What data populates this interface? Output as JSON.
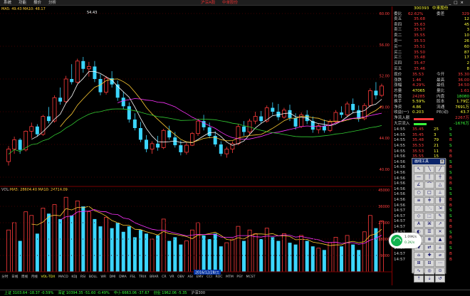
{
  "menu": {
    "items": [
      "系统",
      "功能",
      "报价",
      "分析",
      "扩展市场",
      "资讯",
      "工具",
      "帮助"
    ],
    "center_red": "沪深A股",
    "center_red2": "中单股份",
    "right": "行情 资讯 交易 服务"
  },
  "kline": {
    "ma_legend": "MA5: 49.43  MA10: 48.17",
    "peak_label": "54.43",
    "price_high": 60.0,
    "price_low": 39.0,
    "y_ticks": [
      {
        "v": "60.00"
      },
      {
        "v": "56.00"
      },
      {
        "v": "52.00"
      },
      {
        "v": "48.00"
      },
      {
        "v": "44.00"
      },
      {
        "v": "40.00"
      }
    ],
    "candles": [
      [
        41,
        43,
        40.5,
        42.6
      ],
      [
        42.6,
        44.2,
        42,
        43.8
      ],
      [
        43.8,
        44,
        42,
        42.5
      ],
      [
        42.5,
        45,
        42.3,
        44.9
      ],
      [
        44.9,
        46,
        44,
        45.5
      ],
      [
        45.5,
        45.8,
        44.2,
        44.5
      ],
      [
        44.5,
        47,
        44.3,
        46.8
      ],
      [
        46.8,
        48,
        45.9,
        46.2
      ],
      [
        46.2,
        49.5,
        46,
        49.2
      ],
      [
        49.2,
        50.5,
        48.3,
        48.7
      ],
      [
        48.7,
        52,
        48.5,
        51.6
      ],
      [
        51.6,
        53.5,
        50.9,
        51.2
      ],
      [
        51.2,
        54.2,
        51,
        53.9
      ],
      [
        53.9,
        54.43,
        52.4,
        52.9
      ],
      [
        52.9,
        53.8,
        51.9,
        53.2
      ],
      [
        53.2,
        53.9,
        51.2,
        51.6
      ],
      [
        51.6,
        52.2,
        49.5,
        49.9
      ],
      [
        49.9,
        52,
        49.6,
        51.7
      ],
      [
        51.7,
        52.6,
        50.5,
        50.9
      ],
      [
        50.9,
        51.4,
        48.8,
        49.2
      ],
      [
        49.2,
        50,
        47.7,
        48.1
      ],
      [
        48.1,
        48.6,
        46,
        46.4
      ],
      [
        46.4,
        47.2,
        45,
        45.3
      ],
      [
        45.3,
        46.1,
        43.5,
        43.8
      ],
      [
        43.8,
        44.4,
        42.2,
        42.6
      ],
      [
        42.6,
        43.6,
        42,
        43.3
      ],
      [
        43.3,
        44.3,
        42.4,
        42.8
      ],
      [
        42.8,
        45.2,
        42.6,
        45
      ],
      [
        45,
        45.6,
        43.8,
        44.1
      ],
      [
        44.1,
        44.8,
        42.8,
        43.1
      ],
      [
        43.1,
        43.7,
        41.8,
        42.2
      ],
      [
        42.2,
        43.4,
        41.9,
        43.1
      ],
      [
        43.1,
        44.8,
        43,
        44.6
      ],
      [
        44.6,
        46.5,
        44.3,
        46.2
      ],
      [
        46.2,
        47,
        45,
        45.4
      ],
      [
        45.4,
        46,
        44,
        44.3
      ],
      [
        44.3,
        44.9,
        42.9,
        43.2
      ],
      [
        43.2,
        43.6,
        41.7,
        42
      ],
      [
        42,
        42.9,
        41.5,
        42.6
      ],
      [
        42.6,
        43.6,
        42.1,
        43.3
      ],
      [
        43.3,
        45.8,
        43.1,
        45.5
      ],
      [
        45.5,
        46.2,
        44.3,
        44.8
      ],
      [
        44.8,
        46.5,
        44.5,
        46.2
      ],
      [
        46.2,
        47.4,
        45.8,
        46.8
      ],
      [
        46.8,
        47.5,
        45.9,
        46.2
      ],
      [
        46.2,
        48.2,
        46,
        47.9
      ],
      [
        47.9,
        48.6,
        47,
        47.4
      ],
      [
        47.4,
        48.4,
        46.3,
        46.7
      ],
      [
        46.7,
        47.9,
        46.5,
        47.6
      ],
      [
        47.6,
        48.3,
        46.2,
        46.6
      ],
      [
        46.6,
        47.2,
        45.1,
        45.5
      ],
      [
        45.5,
        47.3,
        45.3,
        47
      ],
      [
        47,
        47.6,
        45.8,
        46.2
      ],
      [
        46.2,
        46.8,
        44.7,
        45.1
      ],
      [
        45.1,
        45.9,
        44.6,
        45.6
      ],
      [
        45.6,
        46.4,
        44.7,
        45
      ],
      [
        45,
        46.4,
        44.8,
        46.1
      ],
      [
        46.1,
        47.6,
        45.9,
        47.3
      ],
      [
        47.3,
        48.1,
        46.6,
        47
      ],
      [
        47,
        48.7,
        46.8,
        48.4
      ],
      [
        48.4,
        49.1,
        47.2,
        47.6
      ],
      [
        47.6,
        48.2,
        46.1,
        46.5
      ],
      [
        46.5,
        48.5,
        46.3,
        48.2
      ],
      [
        48.2,
        50.4,
        48,
        50.1
      ],
      [
        50.1,
        51.2,
        49,
        49.5
      ],
      [
        49.5,
        51,
        49.3,
        50.7
      ]
    ]
  },
  "volume": {
    "legend_name": "VOL:",
    "legend_vals": "MA5: 28604.40  MA10: 24714.09",
    "y_ticks": [
      {
        "v": "45000"
      },
      {
        "v": "36000"
      },
      {
        "v": "27000"
      },
      {
        "v": "18000"
      },
      {
        "v": "9000"
      }
    ],
    "vmax": 45000,
    "values": [
      23,
      27,
      17,
      33,
      31,
      21,
      35,
      32,
      37,
      29,
      41,
      31,
      39,
      36,
      33,
      29,
      25,
      30,
      24,
      27,
      22,
      25,
      19,
      23,
      21,
      18,
      20,
      29,
      17,
      19,
      15,
      17,
      23,
      27,
      20,
      18,
      21,
      14,
      16,
      18,
      25,
      17,
      23,
      21,
      18,
      24,
      19,
      17,
      21,
      16,
      15,
      20,
      17,
      14,
      13,
      12,
      16,
      19,
      14,
      20,
      15,
      12,
      22,
      31,
      24,
      28
    ]
  },
  "date_tag": "2016/12/28/三",
  "tabs": [
    "分时",
    "日线",
    "周线",
    "月线",
    "VOL-TDX",
    "MACD",
    "KDJ",
    "RSI",
    "BOLL",
    "WR",
    "DMI",
    "DMA",
    "FSL",
    "TRIX",
    "BRAR",
    "CR",
    "VR",
    "OBV",
    "ASI",
    "EMV",
    "CCI",
    "ROC",
    "MTM",
    "PSY",
    "MCST"
  ],
  "quote": {
    "code": "300393",
    "name": "中来股份",
    "wei_bi_label": "委比",
    "wei_bi": "62.62%",
    "wei_cha_label": "委差",
    "wei_cha": "329",
    "asks": [
      {
        "n": "卖五",
        "p": "35.68",
        "v": "12"
      },
      {
        "n": "卖四",
        "p": "35.63",
        "v": "45"
      },
      {
        "n": "卖三",
        "p": "35.57",
        "v": "3"
      },
      {
        "n": "卖二",
        "p": "35.55",
        "v": "10"
      },
      {
        "n": "卖一",
        "p": "35.53",
        "v": "26"
      }
    ],
    "bids": [
      {
        "n": "买一",
        "p": "35.51",
        "v": "60"
      },
      {
        "n": "买二",
        "p": "35.50",
        "v": "87"
      },
      {
        "n": "买三",
        "p": "35.48",
        "v": "17"
      },
      {
        "n": "买四",
        "p": "35.47",
        "v": "2"
      },
      {
        "n": "买五",
        "p": "35.46",
        "v": "8"
      }
    ],
    "stats": [
      [
        {
          "t": "现价",
          "c": "#c8c8c8"
        },
        {
          "t": "35.53",
          "c": "#ff3b3b"
        },
        {
          "t": "今开",
          "c": "#c8c8c8"
        },
        {
          "t": "35.30",
          "c": "#ff3b3b"
        }
      ],
      [
        {
          "t": "涨跌",
          "c": "#c8c8c8"
        },
        {
          "t": "1.46",
          "c": "#ff3b3b"
        },
        {
          "t": "最高",
          "c": "#c8c8c8"
        },
        {
          "t": "36.00",
          "c": "#ff3b3b"
        }
      ],
      [
        {
          "t": "涨幅",
          "c": "#c8c8c8"
        },
        {
          "t": "4.29%",
          "c": "#ff3b3b"
        },
        {
          "t": "最低",
          "c": "#c8c8c8"
        },
        {
          "t": "34.50",
          "c": "#ff3b3b"
        }
      ],
      [
        {
          "t": "总量",
          "c": "#c8c8c8"
        },
        {
          "t": "47065",
          "c": "#ffff3b"
        },
        {
          "t": "量比",
          "c": "#c8c8c8"
        },
        {
          "t": "1.61",
          "c": "#ff3b3b"
        }
      ],
      [
        {
          "t": "外盘",
          "c": "#c8c8c8"
        },
        {
          "t": "24285",
          "c": "#ff3b3b"
        },
        {
          "t": "内盘",
          "c": "#c8c8c8"
        },
        {
          "t": "18080",
          "c": "#3bff3b"
        }
      ],
      [
        {
          "t": "换手",
          "c": "#c8c8c8"
        },
        {
          "t": "5.59%",
          "c": "#ffff3b"
        },
        {
          "t": "股本",
          "c": "#c8c8c8"
        },
        {
          "t": "1.79亿",
          "c": "#ffff3b"
        }
      ],
      [
        {
          "t": "净资",
          "c": "#c8c8c8"
        },
        {
          "t": "4.86",
          "c": "#ffff3b"
        },
        {
          "t": "流通",
          "c": "#c8c8c8"
        },
        {
          "t": "7691万",
          "c": "#ffff3b"
        }
      ],
      [
        {
          "t": "收益(一)",
          "c": "#c8c8c8"
        },
        {
          "t": "0.203",
          "c": "#ffff3b"
        },
        {
          "t": "PE(动)",
          "c": "#c8c8c8"
        },
        {
          "t": "43.7",
          "c": "#ffff3b"
        }
      ]
    ],
    "flows": [
      {
        "n": "净流入额",
        "v": "2267万",
        "bar": 0.7,
        "c": "#ff3b3b"
      },
      {
        "n": "大宗流入",
        "v": "-1676万",
        "bar": 0.45,
        "c": "#3bff3b"
      }
    ],
    "ticks": [
      {
        "t": "14:55",
        "p": "35.45",
        "v": "25",
        "s": "S"
      },
      {
        "t": "14:55",
        "p": "35.45",
        "v": "3",
        "s": "S"
      },
      {
        "t": "14:55",
        "p": "35.48",
        "v": "79",
        "s": "B"
      },
      {
        "t": "14:55",
        "p": "35.53",
        "v": "21",
        "s": "S"
      },
      {
        "t": "14:55",
        "p": "35.53",
        "v": "11",
        "s": "B"
      },
      {
        "t": "14:56",
        "p": "35.55",
        "v": "15",
        "s": "B"
      },
      {
        "t": "14:56",
        "p": "35.50",
        "v": "8",
        "s": "S"
      },
      {
        "t": "14:56",
        "p": "35.52",
        "v": "32",
        "s": "B"
      },
      {
        "t": "14:56",
        "p": "35.50",
        "v": "6",
        "s": "S"
      },
      {
        "t": "14:56",
        "p": "35.51",
        "v": "18",
        "s": "B"
      },
      {
        "t": "14:56",
        "p": "35.53",
        "v": "40",
        "s": "B"
      },
      {
        "t": "14:56",
        "p": "35.50",
        "v": "12",
        "s": "S"
      },
      {
        "t": "14:56",
        "p": "35.51",
        "v": "5",
        "s": "S"
      },
      {
        "t": "14:56",
        "p": "35.53",
        "v": "27",
        "s": "B"
      },
      {
        "t": "14:56",
        "p": "35.55",
        "v": "9",
        "s": "B"
      },
      {
        "t": "14:57",
        "p": "35.52",
        "v": "14",
        "s": "S"
      },
      {
        "t": "14:57",
        "p": "35.50",
        "v": "22",
        "s": "S"
      },
      {
        "t": "14:57",
        "p": "35.51",
        "v": "7",
        "s": "B"
      },
      {
        "t": "14:57",
        "p": "35.53",
        "v": "16",
        "s": "B"
      },
      {
        "t": "14:57",
        "p": "35.50",
        "v": "3",
        "s": "S"
      },
      {
        "t": "14:57",
        "p": "35.51",
        "v": "28",
        "s": "B"
      },
      {
        "t": "14:57",
        "p": "35.58",
        "v": "8",
        "s": "B"
      },
      {
        "t": "14:57",
        "p": "35.50",
        "v": "13",
        "s": "S"
      },
      {
        "t": "14:57",
        "p": "35.55",
        "v": "2",
        "s": "B"
      },
      {
        "t": "14:57",
        "p": "35.56",
        "v": "17",
        "s": "B"
      }
    ]
  },
  "toolbar": {
    "title": "画线工具",
    "close": "×",
    "tools": [
      "↖",
      "╲",
      "╱",
      "—",
      "│",
      "┼",
      "∠",
      "⌒",
      "△",
      "○",
      "□",
      "⊥",
      "≡",
      "╪",
      "╫",
      "⋰",
      "⋱",
      "⇲",
      "◇",
      "⬚",
      "✎",
      "A",
      "⌘",
      "↗",
      "◐",
      "☰",
      "✕",
      "⊕",
      "⊗",
      "▲",
      "▼",
      "⇄",
      "⟂",
      "⌂",
      "✚",
      "⌀",
      "⊞",
      "⊟",
      "⋯",
      "∿",
      "◎",
      "⊙",
      "⇡",
      "⇣",
      "↺"
    ]
  },
  "bubble": {
    "l1": "1.09K/s",
    "l2": "0.2K/s"
  },
  "status": [
    "上证 3103.64 -18.37 -0.59%",
    "深证 10394.35 -51.60 -0.49%",
    "中小 6663.06 -37.67",
    "创业 1962.06 -5.35",
    "沪深300"
  ]
}
